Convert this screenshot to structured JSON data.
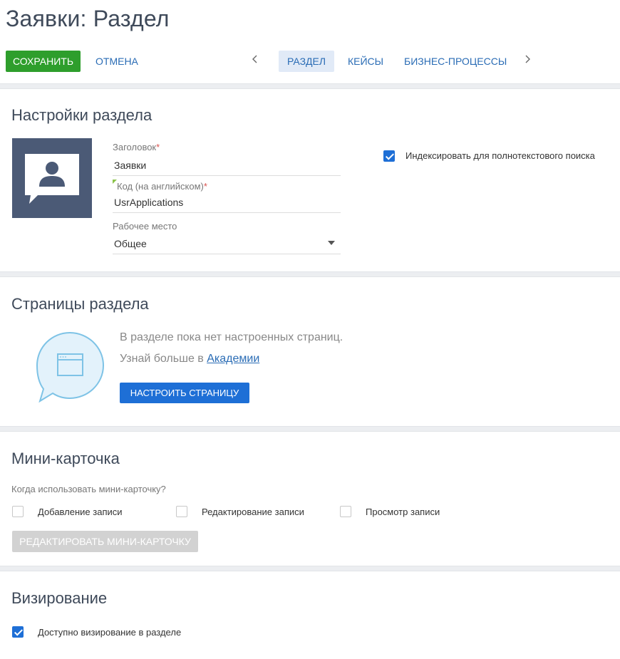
{
  "page": {
    "title": "Заявки: Раздел"
  },
  "toolbar": {
    "save_label": "СОХРАНИТЬ",
    "cancel_label": "ОТМЕНА",
    "tabs": [
      {
        "label": "РАЗДЕЛ",
        "active": true
      },
      {
        "label": "КЕЙСЫ",
        "active": false
      },
      {
        "label": "БИЗНЕС-ПРОЦЕССЫ",
        "active": false
      }
    ],
    "prev_icon": "chevron-left-icon",
    "next_icon": "chevron-right-icon"
  },
  "section_settings": {
    "title": "Настройки раздела",
    "icon": "section-contact-icon",
    "fields": {
      "caption": {
        "label": "Заголовок",
        "required_mark": "*",
        "value": "Заявки"
      },
      "code": {
        "label": "Код (на английском)",
        "required_mark": "*",
        "value": "UsrApplications"
      },
      "workplace": {
        "label": "Рабочее место",
        "value": "Общее"
      }
    },
    "fulltext_index": {
      "label": "Индексировать для полнотекстового поиска",
      "checked": true
    }
  },
  "section_pages": {
    "title": "Страницы раздела",
    "empty_text": "В разделе пока нет настроенных страниц.",
    "learn_prefix": "Узнай больше в ",
    "learn_link": "Академии",
    "configure_button": "НАСТРОИТЬ СТРАНИЦУ",
    "icon": "page-bubble-icon"
  },
  "section_minicard": {
    "title": "Мини-карточка",
    "question": "Когда использовать мини-карточку?",
    "options": [
      {
        "label": "Добавление записи",
        "checked": false
      },
      {
        "label": "Редактирование записи",
        "checked": false
      },
      {
        "label": "Просмотр записи",
        "checked": false
      }
    ],
    "edit_button": "РЕДАКТИРОВАТЬ МИНИ-КАРТОЧКУ"
  },
  "section_visa": {
    "title": "Визирование",
    "option": {
      "label": "Доступно визирование в разделе",
      "checked": true
    }
  },
  "colors": {
    "save": "#2e9e2c",
    "primary": "#1e6fd6",
    "link": "#2a6cb5",
    "icon_bg": "#4b5a76",
    "disabled": "#d2d2d2"
  }
}
